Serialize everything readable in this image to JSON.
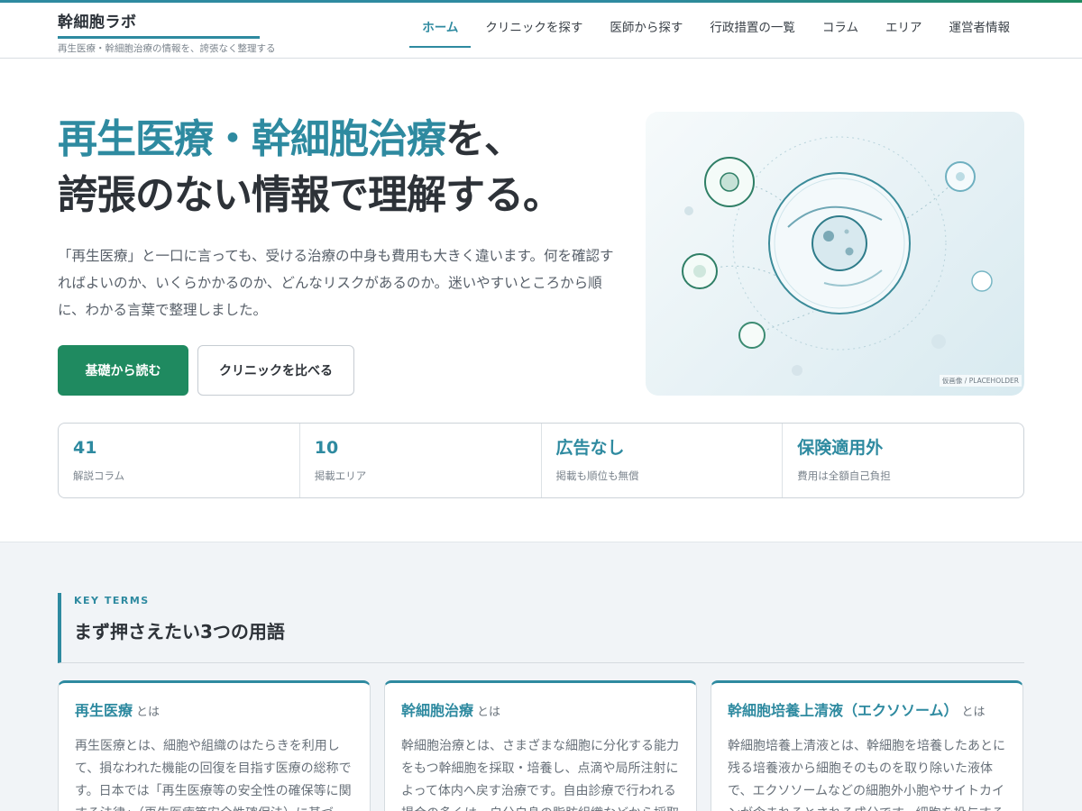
{
  "header": {
    "logo_title": "幹細胞ラボ",
    "logo_subtitle": "再生医療・幹細胞治療の情報を、誇張なく整理する",
    "nav": [
      {
        "label": "ホーム",
        "active": true
      },
      {
        "label": "クリニックを探す",
        "active": false
      },
      {
        "label": "医師から探す",
        "active": false
      },
      {
        "label": "行政措置の一覧",
        "active": false
      },
      {
        "label": "コラム",
        "active": false
      },
      {
        "label": "エリア",
        "active": false
      },
      {
        "label": "運営者情報",
        "active": false
      }
    ]
  },
  "hero": {
    "title_accent": "再生医療・幹細胞治療",
    "title_rest": "を、",
    "title_line2": "誇張のない情報で理解する。",
    "description": "「再生医療」と一口に言っても、受ける治療の中身も費用も大きく違います。何を確認すればよいのか、いくらかかるのか、どんなリスクがあるのか。迷いやすいところから順に、わかる言葉で整理しました。",
    "primary_button": "基礎から読む",
    "secondary_button": "クリニックを比べる",
    "image_label": "仮画像 / PLACEHOLDER"
  },
  "stats": [
    {
      "value": "41",
      "label": "解説コラム"
    },
    {
      "value": "10",
      "label": "掲載エリア"
    },
    {
      "value": "広告なし",
      "label": "掲載も順位も無償"
    },
    {
      "value": "保険適用外",
      "label": "費用は全額自己負担"
    }
  ],
  "terms": {
    "eyebrow": "KEY TERMS",
    "title": "まず押さえたい3つの用語",
    "cards": [
      {
        "term": "再生医療",
        "suffix": "とは",
        "body": "再生医療とは、細胞や組織のはたらきを利用して、損なわれた機能の回復を目指す医療の総称です。日本では「再生医療等の安全性の確保等に関する法律」（再生医療等安全性確保法）に基づき、リスクに応じ"
      },
      {
        "term": "幹細胞治療",
        "suffix": "とは",
        "body": "幹細胞治療とは、さまざまな細胞に分化する能力をもつ幹細胞を採取・培養し、点滴や局所注射によって体内へ戻す治療です。自由診療で行われる場合の多くは、自分自身の脂肪組織などから採取した間葉系"
      },
      {
        "term": "幹細胞培養上清液（エクソソーム）",
        "suffix": "とは",
        "body": "幹細胞培養上清液とは、幹細胞を培養したあとに残る培養液から細胞そのものを取り除いた液体で、エクソソームなどの細胞外小胞やサイトカインが含まれるとされる成分です。細胞を投与するわけではない"
      }
    ]
  },
  "colors": {
    "accent": "#2e8aa0",
    "primary_button": "#1f8a60"
  }
}
